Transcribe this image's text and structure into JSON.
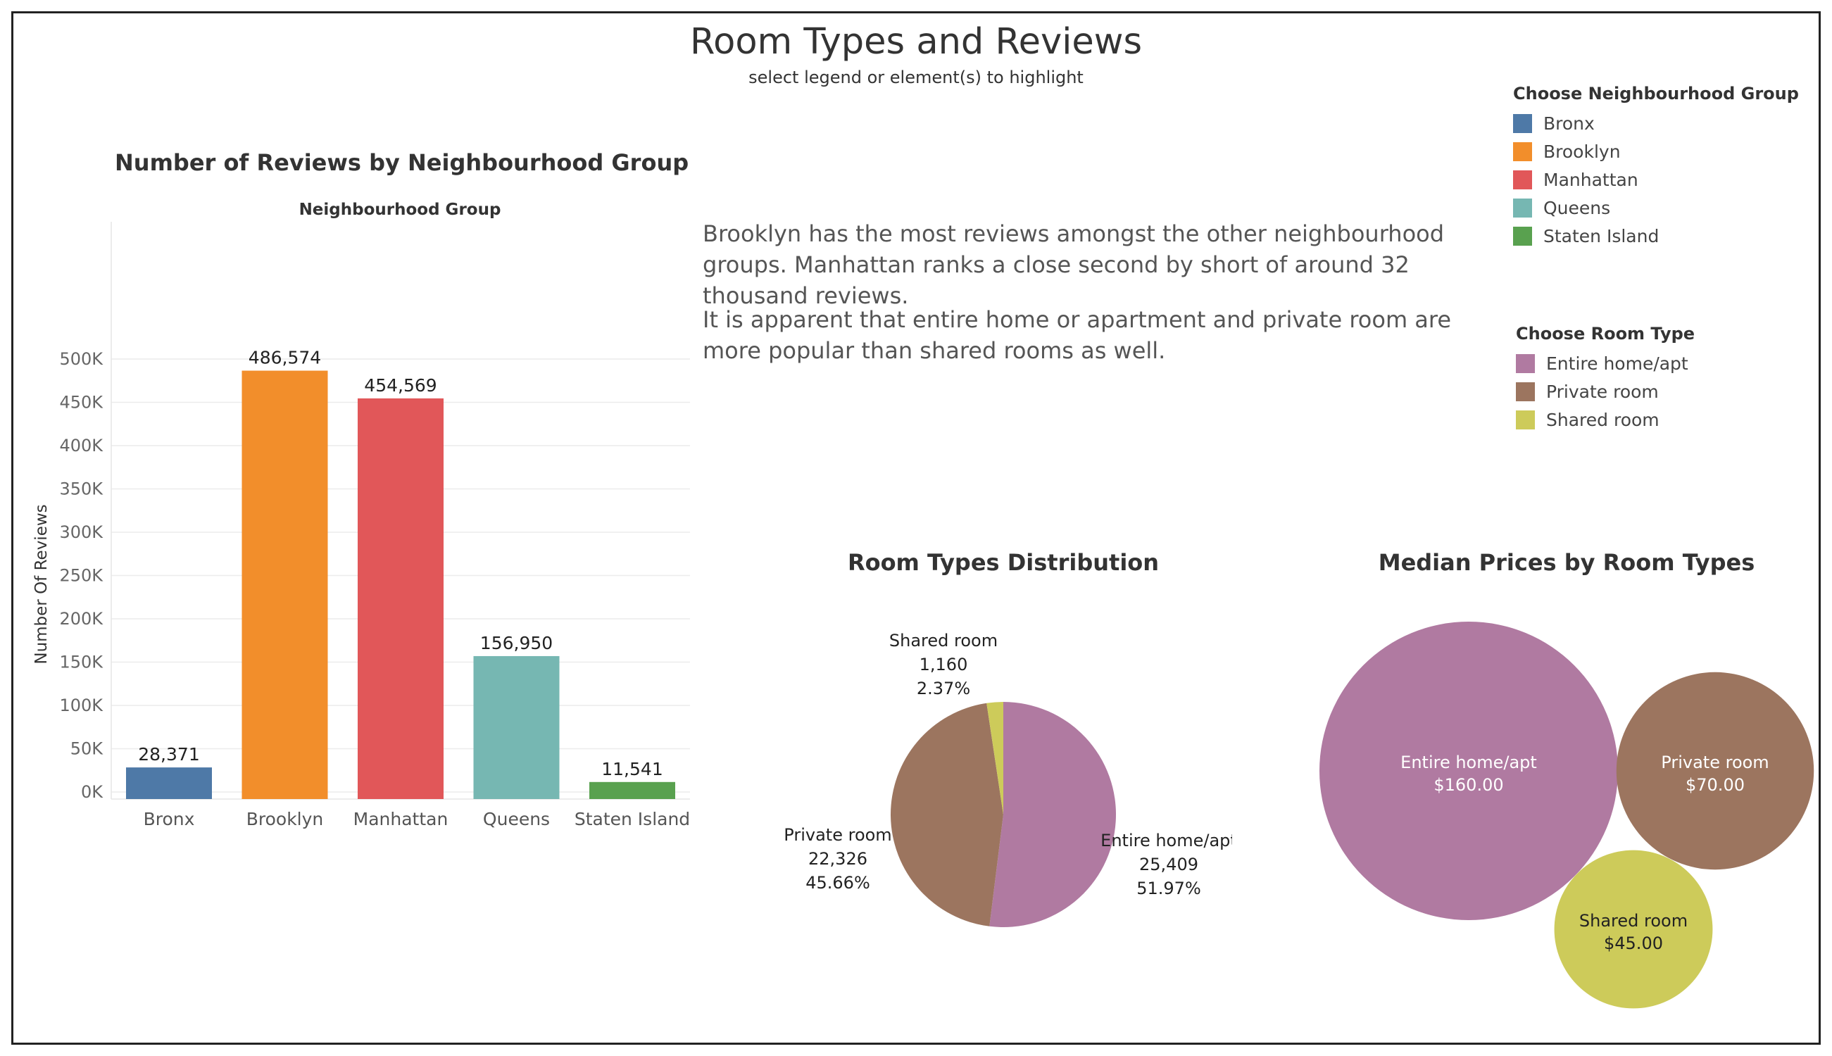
{
  "header": {
    "title": "Room Types and Reviews",
    "subtitle": "select legend or element(s) to highlight"
  },
  "narrative": {
    "p1": "Brooklyn has the most reviews amongst the other neighbourhood groups. Manhattan ranks a close second by short of around 32 thousand reviews.",
    "p2": "It is apparent that entire home or apartment and private room are more popular than shared rooms as well."
  },
  "legend_neighbourhood": {
    "title": "Choose Neighbourhood Group",
    "items": [
      {
        "label": "Bronx",
        "color": "#4e79a7"
      },
      {
        "label": "Brooklyn",
        "color": "#f28e2b"
      },
      {
        "label": "Manhattan",
        "color": "#e15759"
      },
      {
        "label": "Queens",
        "color": "#76b7b2"
      },
      {
        "label": "Staten Island",
        "color": "#59a14f"
      }
    ]
  },
  "legend_room": {
    "title": "Choose Room Type",
    "items": [
      {
        "label": "Entire home/apt",
        "color": "#b07aa1"
      },
      {
        "label": "Private room",
        "color": "#9c755f"
      },
      {
        "label": "Shared room",
        "color": "#cdcb5a"
      }
    ]
  },
  "chart_data": [
    {
      "type": "bar",
      "title": "Number of Reviews by Neighbourhood Group",
      "column_header": "Neighbourhood Group",
      "ylabel": "Number Of Reviews",
      "ylim": [
        0,
        530000
      ],
      "yticks": [
        0,
        50000,
        100000,
        150000,
        200000,
        250000,
        300000,
        350000,
        400000,
        450000,
        500000
      ],
      "ytick_labels": [
        "0K",
        "50K",
        "100K",
        "150K",
        "200K",
        "250K",
        "300K",
        "350K",
        "400K",
        "450K",
        "500K"
      ],
      "grid": true,
      "categories": [
        "Bronx",
        "Brooklyn",
        "Manhattan",
        "Queens",
        "Staten Island"
      ],
      "values": [
        28371,
        486574,
        454569,
        156950,
        11541
      ],
      "value_labels": [
        "28,371",
        "486,574",
        "454,569",
        "156,950",
        "11,541"
      ],
      "colors": [
        "#4e79a7",
        "#f28e2b",
        "#e15759",
        "#76b7b2",
        "#59a14f"
      ]
    },
    {
      "type": "pie",
      "title": "Room Types Distribution",
      "slices": [
        {
          "label": "Entire home/apt",
          "value": 25409,
          "value_label": "25,409",
          "percent": "51.97%",
          "color": "#b07aa1"
        },
        {
          "label": "Private room",
          "value": 22326,
          "value_label": "22,326",
          "percent": "45.66%",
          "color": "#9c755f"
        },
        {
          "label": "Shared room",
          "value": 1160,
          "value_label": "1,160",
          "percent": "2.37%",
          "color": "#cdcb5a"
        }
      ]
    },
    {
      "type": "bubble",
      "title": "Median Prices by Room Types",
      "bubbles": [
        {
          "label": "Entire home/apt",
          "value": 160.0,
          "value_label": "$160.00",
          "color": "#b07aa1"
        },
        {
          "label": "Private room",
          "value": 70.0,
          "value_label": "$70.00",
          "color": "#9c755f"
        },
        {
          "label": "Shared room",
          "value": 45.0,
          "value_label": "$45.00",
          "color": "#cdcb5a"
        }
      ]
    }
  ]
}
